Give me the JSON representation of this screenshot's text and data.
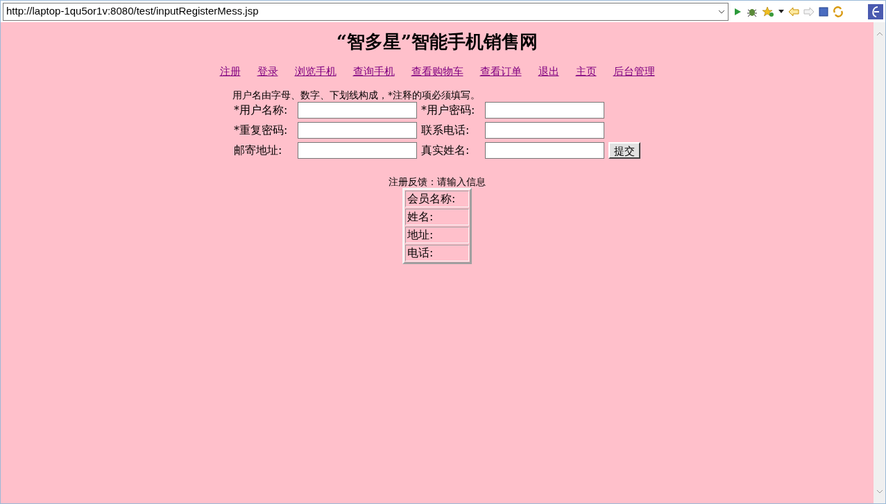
{
  "browser": {
    "url": "http://laptop-1qu5or1v:8080/test/inputRegisterMess.jsp"
  },
  "page": {
    "title": "“智多星”智能手机销售网",
    "nav": [
      "注册",
      "登录",
      "浏览手机",
      "查询手机",
      "查看购物车",
      "查看订单",
      "退出",
      "主页",
      "后台管理"
    ],
    "hint": "用户名由字母、数字、下划线构成，*注释的项必须填写。",
    "form": {
      "rows": [
        {
          "fields": [
            {
              "label": "*用户名称:"
            },
            {
              "label": "*用户密码:"
            }
          ]
        },
        {
          "fields": [
            {
              "label": "*重复密码:"
            },
            {
              "label": "联系电话:"
            }
          ]
        },
        {
          "fields": [
            {
              "label": "邮寄地址:"
            },
            {
              "label": "真实姓名:"
            }
          ]
        }
      ],
      "submit": "提交"
    },
    "feedback": "注册反馈：请输入信息",
    "result_rows": [
      "会员名称:",
      "姓名:",
      "地址:",
      "电话:"
    ]
  }
}
